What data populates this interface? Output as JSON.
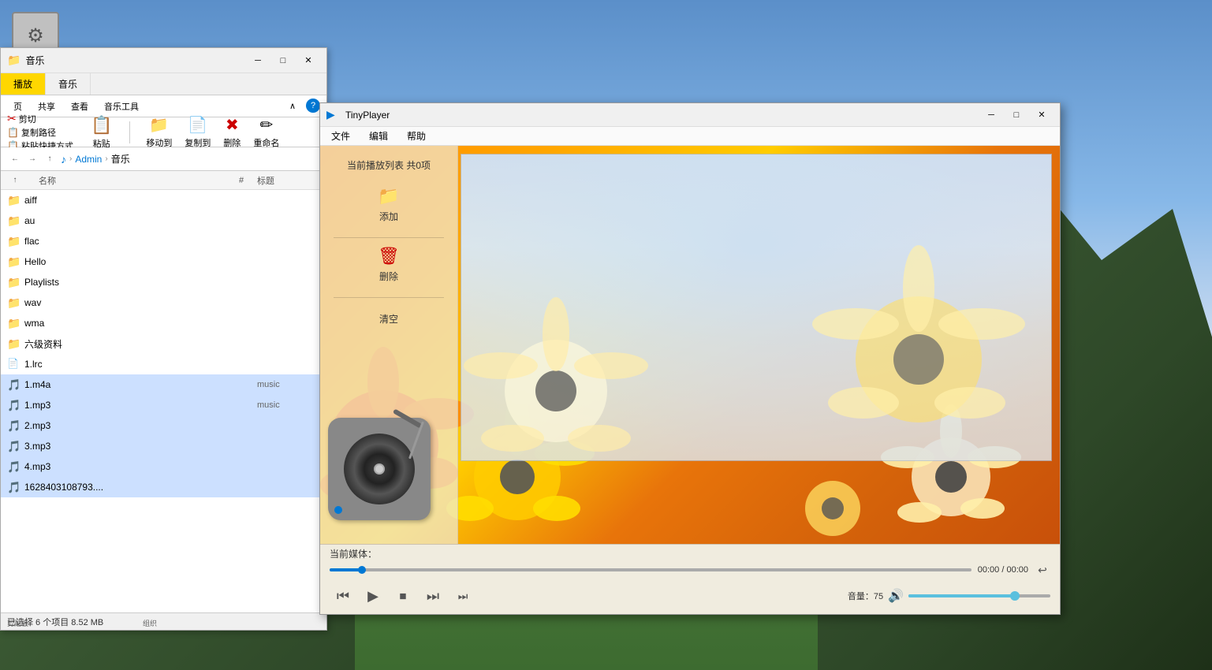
{
  "desktop": {
    "bg_description": "Mountain landscape with sky and forest"
  },
  "taskbar": {
    "gear_icon": "⚙"
  },
  "explorer": {
    "title": "音乐",
    "tabs": [
      {
        "label": "播放",
        "active": true,
        "highlight": true
      },
      {
        "label": "音乐",
        "active": false,
        "highlight": false
      }
    ],
    "second_tabs": [
      {
        "label": "页"
      },
      {
        "label": "共享"
      },
      {
        "label": "查看"
      },
      {
        "label": "音乐工具"
      }
    ],
    "ribbon": {
      "cut_label": "剪切",
      "copy_path_label": "复制路径",
      "paste_shortcut_label": "粘贴快捷方式",
      "paste_label": "粘贴",
      "move_to_label": "移动到",
      "copy_to_label": "复制到",
      "delete_label": "删除",
      "rename_label": "重命名",
      "clipboard_group": "剪贴板",
      "organize_group": "组织"
    },
    "address": {
      "back_icon": "←",
      "forward_icon": "→",
      "up_icon": "↑",
      "music_icon": "♪",
      "path": [
        "Admin",
        "音乐"
      ]
    },
    "columns": {
      "name": "名称",
      "num": "#",
      "title": "标题",
      "up_arrow": "↑"
    },
    "files": [
      {
        "name": "aiff",
        "type": "folder",
        "selected": false
      },
      {
        "name": "au",
        "type": "folder",
        "selected": false
      },
      {
        "name": "flac",
        "type": "folder",
        "selected": false
      },
      {
        "name": "Hello",
        "type": "folder",
        "selected": false
      },
      {
        "name": "Playlists",
        "type": "folder",
        "selected": false
      },
      {
        "name": "wav",
        "type": "folder",
        "selected": false
      },
      {
        "name": "wma",
        "type": "folder",
        "selected": false
      },
      {
        "name": "六级资料",
        "type": "folder",
        "selected": false
      },
      {
        "name": "1.lrc",
        "type": "file",
        "selected": false
      },
      {
        "name": "1.m4a",
        "type": "music",
        "num": "",
        "title": "music",
        "selected": true
      },
      {
        "name": "1.mp3",
        "type": "music",
        "num": "",
        "title": "music",
        "selected": true
      },
      {
        "name": "2.mp3",
        "type": "music",
        "num": "",
        "title": "",
        "selected": true
      },
      {
        "name": "3.mp3",
        "type": "music",
        "num": "",
        "title": "",
        "selected": true
      },
      {
        "name": "4.mp3",
        "type": "music",
        "num": "",
        "title": "",
        "selected": true
      },
      {
        "name": "1628403108793....",
        "type": "music",
        "num": "",
        "title": "",
        "selected": true
      }
    ],
    "status": "已选择 6 个项目  8.52 MB"
  },
  "player": {
    "app_icon": "▶",
    "title": "TinyPlayer",
    "menu_items": [
      "文件",
      "编辑",
      "帮助"
    ],
    "playlist_header": "当前播放列表 共0项",
    "add_btn_label": "添加",
    "delete_btn_label": "删除",
    "clear_btn_label": "清空",
    "current_media_label": "当前媒体：",
    "time": "00:00 / 00:00",
    "volume_label": "音量：75",
    "controls": {
      "prev": "⏮",
      "play": "▶",
      "stop": "⏹",
      "next": "⏭",
      "skip": "⏭"
    },
    "progress_percent": 0,
    "volume_percent": 75
  }
}
